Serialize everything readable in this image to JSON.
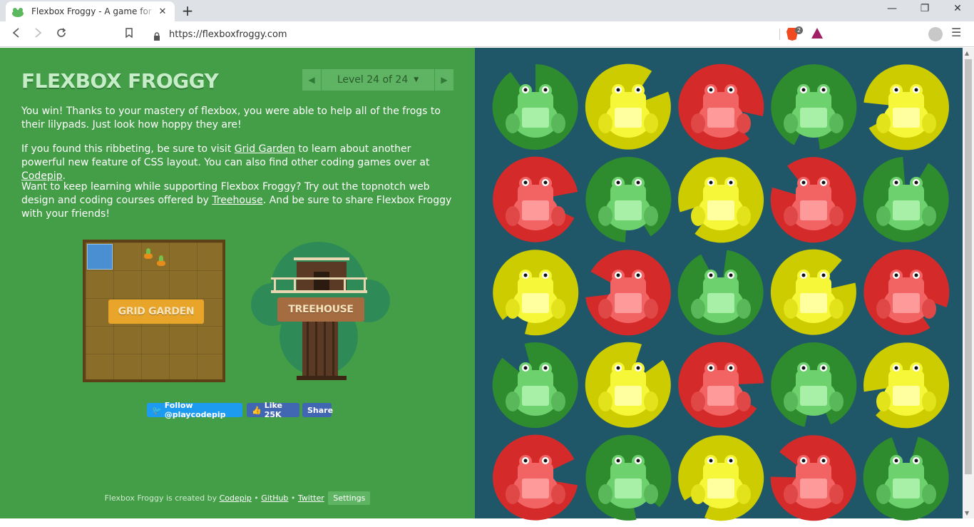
{
  "browser": {
    "tab_title": "Flexbox Froggy - A game for learning CSS flexbox",
    "tab_close": "✕",
    "new_tab": "+",
    "url": "https://flexboxfroggy.com",
    "shield_count": "2",
    "win_minimize": "—",
    "win_restore": "❐",
    "win_close": "✕"
  },
  "game": {
    "title": "FLEXBOX FROGGY",
    "level_label": "Level 24 of 24",
    "level_caret": "▼",
    "prev": "◀",
    "next": "▶",
    "win_msg": "You win! Thanks to your mastery of flexbox, you were able to help all of the frogs to their lilypads. Just look how hoppy they are!",
    "p2_a": "If you found this ribbeting, be sure to visit ",
    "p2_link1": "Grid Garden",
    "p2_b": " to learn about another powerful new feature of CSS layout. You can also find other coding games over at ",
    "p2_link2": "Codepip",
    "p2_c": ".",
    "p3_a": "Want to keep learning while supporting Flexbox Froggy? Try out the topnotch web design and coding courses offered by ",
    "p3_link": "Treehouse",
    "p3_b": ". And be sure to share Flexbox Froggy with your friends!",
    "grid_garden_badge": "GRID GARDEN",
    "treehouse_badge": "TREEHOUSE",
    "twitter_btn": "Follow @playcodepip",
    "fb_like": "Like 25K",
    "fb_share": "Share",
    "footer_text": "Flexbox Froggy is created by ",
    "footer_codepip": "Codepip",
    "footer_sep": " • ",
    "footer_github": "GitHub",
    "footer_twitter": "Twitter",
    "footer_settings": "Settings"
  },
  "colors": {
    "green_pad": "#2e8b2e",
    "green_frog": "#6dd16d",
    "yellow_pad": "#cccc00",
    "yellow_frog": "#f7f73a",
    "red_pad": "#d42a2a",
    "red_frog": "#f26464",
    "board_bg": "#1f5768",
    "left_bg": "#439e47"
  },
  "board": {
    "rows": [
      [
        "green",
        "yellow",
        "red",
        "green",
        "yellow"
      ],
      [
        "red",
        "green",
        "yellow",
        "red",
        "green"
      ],
      [
        "yellow",
        "red",
        "green",
        "yellow",
        "red"
      ],
      [
        "green",
        "yellow",
        "red",
        "green",
        "yellow"
      ],
      [
        "red",
        "green",
        "yellow",
        "red",
        "green"
      ]
    ]
  }
}
